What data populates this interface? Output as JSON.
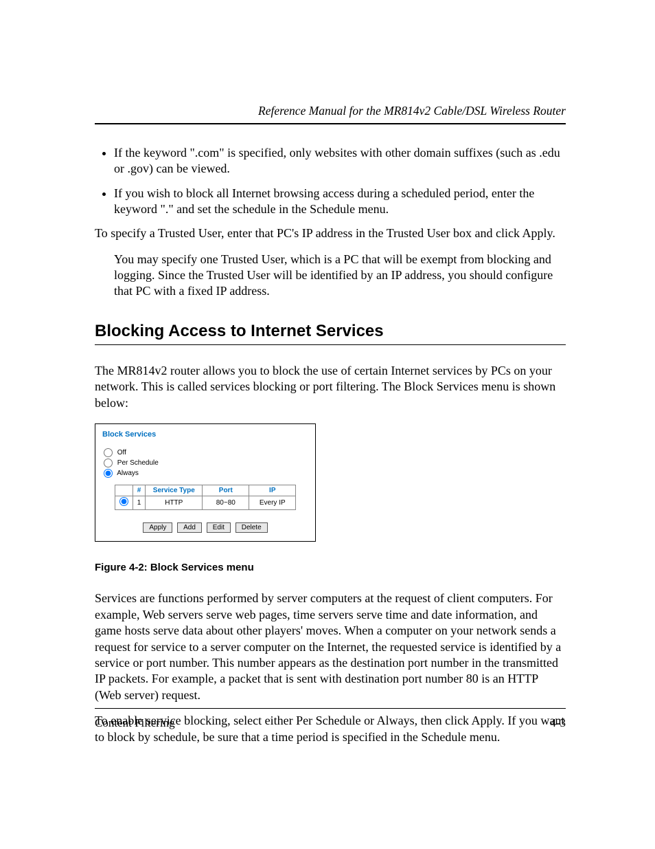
{
  "header": {
    "running_title": "Reference Manual for the MR814v2 Cable/DSL Wireless Router"
  },
  "bullets": [
    "If the keyword \".com\" is specified, only websites with other domain suffixes (such as .edu or .gov) can be viewed.",
    "If you wish to block all Internet browsing access during a scheduled period, enter the keyword \".\" and set the schedule in the Schedule menu."
  ],
  "para": {
    "trusted_intro": "To specify a Trusted User, enter that PC's IP address in the Trusted User box and click Apply.",
    "trusted_detail": "You may specify one Trusted User, which is a PC that will be exempt from blocking and logging. Since the Trusted User will be identified by an IP address, you should configure that PC with a fixed IP address.",
    "services_intro": "The MR814v2 router allows you to block the use of certain Internet services by PCs on your network. This is called services blocking or port filtering. The Block Services menu is shown below:",
    "services_body": "Services are functions performed by server computers at the request of client computers. For example, Web servers serve web pages, time servers serve time and date information, and game hosts serve data about other players' moves. When a computer on your network sends a request for service to a server computer on the Internet, the requested service is identified by a service or port number. This number appears as the destination port number in the transmitted IP packets. For example, a packet that is sent with destination port number 80 is an HTTP (Web server) request.",
    "enable_body": "To enable service blocking, select either Per Schedule or Always, then click Apply. If you want to block by schedule, be sure that a time period is specified in the Schedule menu."
  },
  "section_heading": "Blocking Access to Internet Services",
  "figure_caption": "Figure 4-2:  Block Services menu",
  "panel": {
    "title": "Block Services",
    "options": {
      "off": "Off",
      "per_schedule": "Per Schedule",
      "always": "Always"
    },
    "table": {
      "headers": {
        "num": "#",
        "service_type": "Service Type",
        "port": "Port",
        "ip": "IP"
      },
      "row": {
        "num": "1",
        "service_type": "HTTP",
        "port": "80~80",
        "ip": "Every IP"
      }
    },
    "buttons": {
      "apply": "Apply",
      "add": "Add",
      "edit": "Edit",
      "delete": "Delete"
    }
  },
  "footer": {
    "left": "Content Filtering",
    "right": "4-3"
  }
}
